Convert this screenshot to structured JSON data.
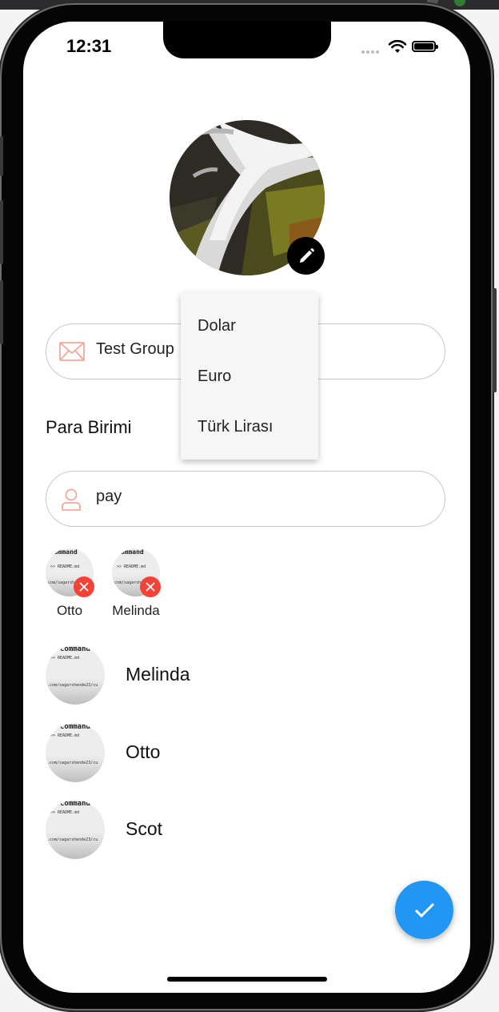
{
  "status_bar": {
    "time": "12:31"
  },
  "group_name_field": {
    "value": "Test Group",
    "icon": "mail-icon"
  },
  "currency": {
    "label": "Para Birimi",
    "options": [
      "Dolar",
      "Euro",
      "Türk Lirası"
    ]
  },
  "member_search": {
    "value": "pay",
    "icon": "person-icon"
  },
  "selected_members": [
    {
      "name": "Otto"
    },
    {
      "name": "Melinda"
    }
  ],
  "member_list": [
    {
      "name": "Melinda"
    },
    {
      "name": "Otto"
    },
    {
      "name": "Scot"
    }
  ],
  "thumbnail_text": {
    "line1": "command",
    "line2": ">> README.md",
    "line3": ".com/sagarshende23/cu"
  },
  "colors": {
    "fab": "#2196f3",
    "remove_badge": "#f44336",
    "field_icon": "#f4a89a"
  }
}
